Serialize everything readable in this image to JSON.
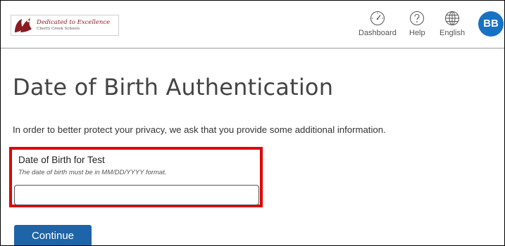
{
  "header": {
    "logo": {
      "tagline": "Dedicated to Excellence",
      "organization": "Cherry Creek Schools"
    },
    "nav": [
      {
        "label": "Dashboard",
        "icon": "dashboard-gauge-icon"
      },
      {
        "label": "Help",
        "icon": "help-question-icon"
      },
      {
        "label": "English",
        "icon": "globe-icon"
      }
    ],
    "avatar_initials": "BB",
    "avatar_color": "#1672c4"
  },
  "main": {
    "title": "Date of Birth Authentication",
    "intro": "In order to better protect your privacy, we ask that you provide some additional information.",
    "field": {
      "label": "Date of Birth for Test",
      "hint": "The date of birth must be in MM/DD/YYYY format.",
      "value": "",
      "placeholder": ""
    },
    "continue_label": "Continue"
  },
  "colors": {
    "accent": "#1e64a8",
    "highlight_border": "#e00000",
    "logo_brand": "#8b1c24"
  }
}
